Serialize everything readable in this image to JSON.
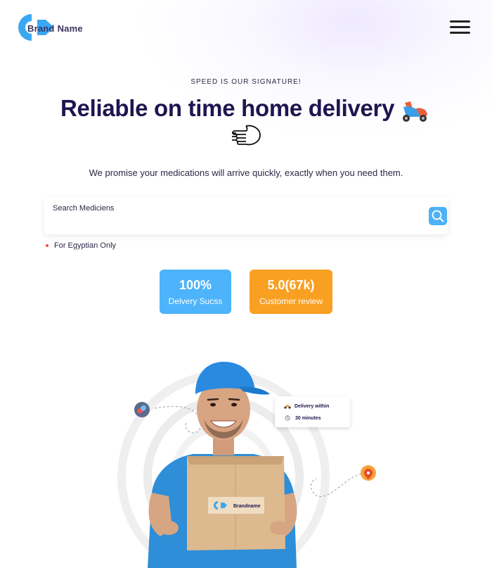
{
  "brand": {
    "part1": "Brand",
    "part2": "Name"
  },
  "hero": {
    "eyebrow": "SPEED IS OUR SIGNATURE!",
    "title": "Reliable on time home delivery",
    "subtitle": "We promise your medications will arrive quickly, exactly when you need them."
  },
  "search": {
    "placeholder": "Search Mediciens"
  },
  "note": "For Egyptian Only",
  "stats": [
    {
      "value": "100%",
      "label": "Delvery Sucss"
    },
    {
      "value": "5.0(67k)",
      "label": "Customer review"
    }
  ],
  "delivery_card": {
    "line1": "Delivery within",
    "line2": "30 minutes"
  },
  "box_label": "Brandname",
  "colors": {
    "primary_dark": "#1d1650",
    "accent_blue": "#4db3fb",
    "accent_orange": "#f9a023",
    "note_red": "#ef4b4b"
  },
  "icons": [
    "menu-icon",
    "scooter-icon",
    "fist-icon",
    "search-icon",
    "pill-icon",
    "location-pin-icon",
    "clock-icon"
  ]
}
